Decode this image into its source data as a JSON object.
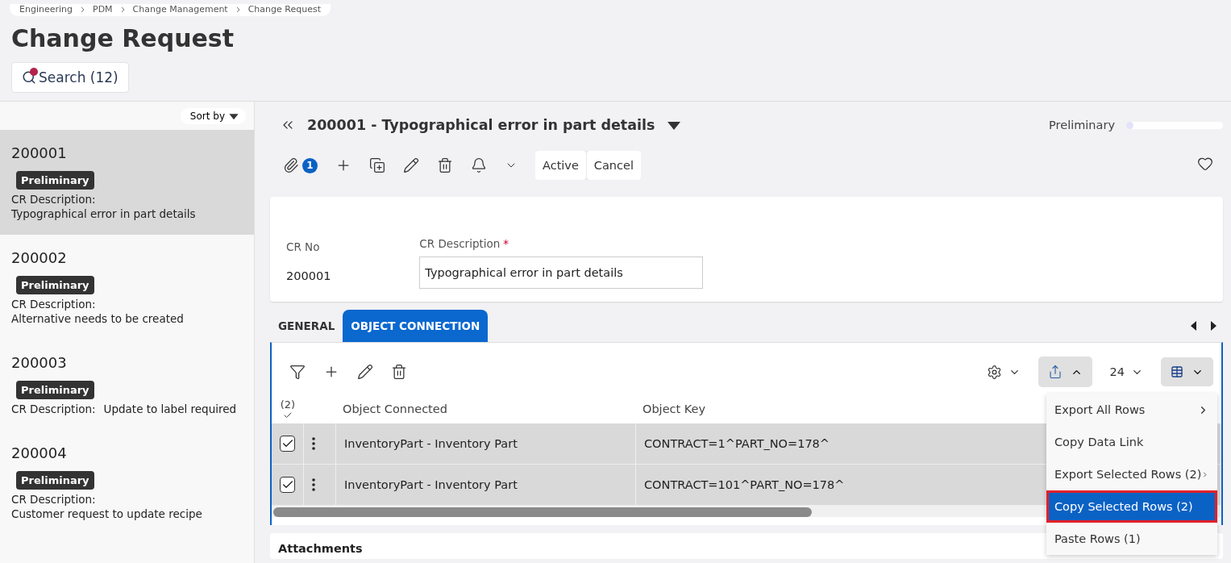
{
  "breadcrumb": [
    "Engineering",
    "PDM",
    "Change Management",
    "Change Request"
  ],
  "page_title": "Change Request",
  "search_button": {
    "label": "Search (12)",
    "badge": true
  },
  "sidebar": {
    "sort_label": "Sort by",
    "items": [
      {
        "number": "200001",
        "status": "Preliminary",
        "label": "CR Description:",
        "description": "Typographical error in part details",
        "kind": "stacked",
        "selected": true
      },
      {
        "number": "200002",
        "status": "Preliminary",
        "label": "CR Description:",
        "description": "Alternative needs to be created",
        "kind": "stacked",
        "selected": false
      },
      {
        "number": "200003",
        "status": "Preliminary",
        "label": "CR Description:",
        "description": "Update to label required",
        "kind": "inline",
        "selected": false
      },
      {
        "number": "200004",
        "status": "Preliminary",
        "label": "CR Description:",
        "description": "Customer request to update recipe",
        "kind": "stacked",
        "selected": false
      }
    ]
  },
  "record": {
    "title": "200001 - Typographical error in part details",
    "status": "Preliminary",
    "level": 0.05,
    "attachment_count": "1",
    "actions": [
      "Active",
      "Cancel"
    ]
  },
  "form": {
    "fields": [
      {
        "label": "CR No",
        "value": "200001",
        "kind": "text"
      },
      {
        "label": "CR Description",
        "value": "Typographical error in part details",
        "kind": "input",
        "required_mark": "*"
      }
    ]
  },
  "tabs": [
    {
      "label": "GENERAL",
      "selected": false
    },
    {
      "label": "OBJECT CONNECTION",
      "selected": true
    }
  ],
  "table": {
    "page_size": "24",
    "selected_count": "(2)",
    "columns": [
      "Object Connected",
      "Object Key"
    ],
    "rows": [
      {
        "cells": [
          "InventoryPart - Inventory Part",
          "CONTRACT=1^PART_NO=178^"
        ],
        "selected": true
      },
      {
        "cells": [
          "InventoryPart - Inventory Part",
          "CONTRACT=101^PART_NO=178^"
        ],
        "selected": true
      }
    ]
  },
  "export_menu": {
    "items": [
      {
        "label": "Export All Rows",
        "submenu": true,
        "selected": false,
        "annotated": false
      },
      {
        "label": "Copy Data Link",
        "submenu": false,
        "selected": false,
        "annotated": false
      },
      {
        "label": "Export Selected Rows (2)",
        "submenu": true,
        "selected": false,
        "annotated": false
      },
      {
        "label": "Copy Selected Rows (2)",
        "submenu": false,
        "selected": true,
        "annotated": true
      },
      {
        "label": "Paste Rows (1)",
        "submenu": false,
        "selected": false,
        "annotated": false
      }
    ]
  },
  "attachments": {
    "title": "Attachments"
  }
}
